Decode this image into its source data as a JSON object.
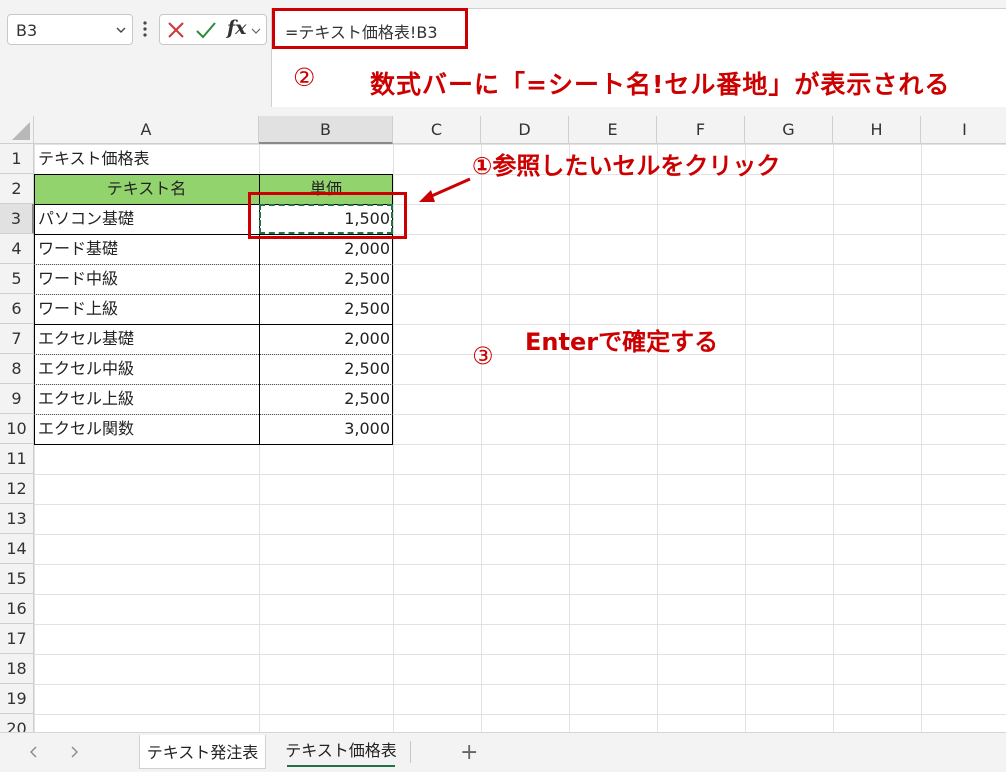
{
  "name_box": {
    "value": "B3"
  },
  "formula_bar": {
    "fx_label": "fx",
    "formula": "=テキスト価格表!B3"
  },
  "annotations": {
    "step1": "①参照したいセルをクリック",
    "step2_num": "②",
    "step2": "数式バーに「=シート名!セル番地」が表示される",
    "step3_num": "③",
    "step3": "Enterで確定する"
  },
  "columns": [
    "A",
    "B",
    "C",
    "D",
    "E",
    "F",
    "G",
    "H",
    "I"
  ],
  "rows": [
    "1",
    "2",
    "3",
    "4",
    "5",
    "6",
    "7",
    "8",
    "9",
    "10",
    "11",
    "12",
    "13",
    "14",
    "15",
    "16",
    "17",
    "18",
    "19",
    "20"
  ],
  "sheet": {
    "title": "テキスト価格表",
    "header": {
      "name": "テキスト名",
      "price": "単価"
    },
    "items": [
      {
        "name": "パソコン基礎",
        "price": "1,500"
      },
      {
        "name": "ワード基礎",
        "price": "2,000"
      },
      {
        "name": "ワード中級",
        "price": "2,500"
      },
      {
        "name": "ワード上級",
        "price": "2,500"
      },
      {
        "name": "エクセル基礎",
        "price": "2,000"
      },
      {
        "name": "エクセル中級",
        "price": "2,500"
      },
      {
        "name": "エクセル上級",
        "price": "2,500"
      },
      {
        "name": "エクセル関数",
        "price": "3,000"
      }
    ]
  },
  "tabs": [
    {
      "label": "テキスト発注表"
    },
    {
      "label": "テキスト価格表",
      "active": true
    }
  ],
  "colors": {
    "accent": "#cc0000",
    "header_fill": "#92d36e",
    "excel_green": "#217346"
  }
}
